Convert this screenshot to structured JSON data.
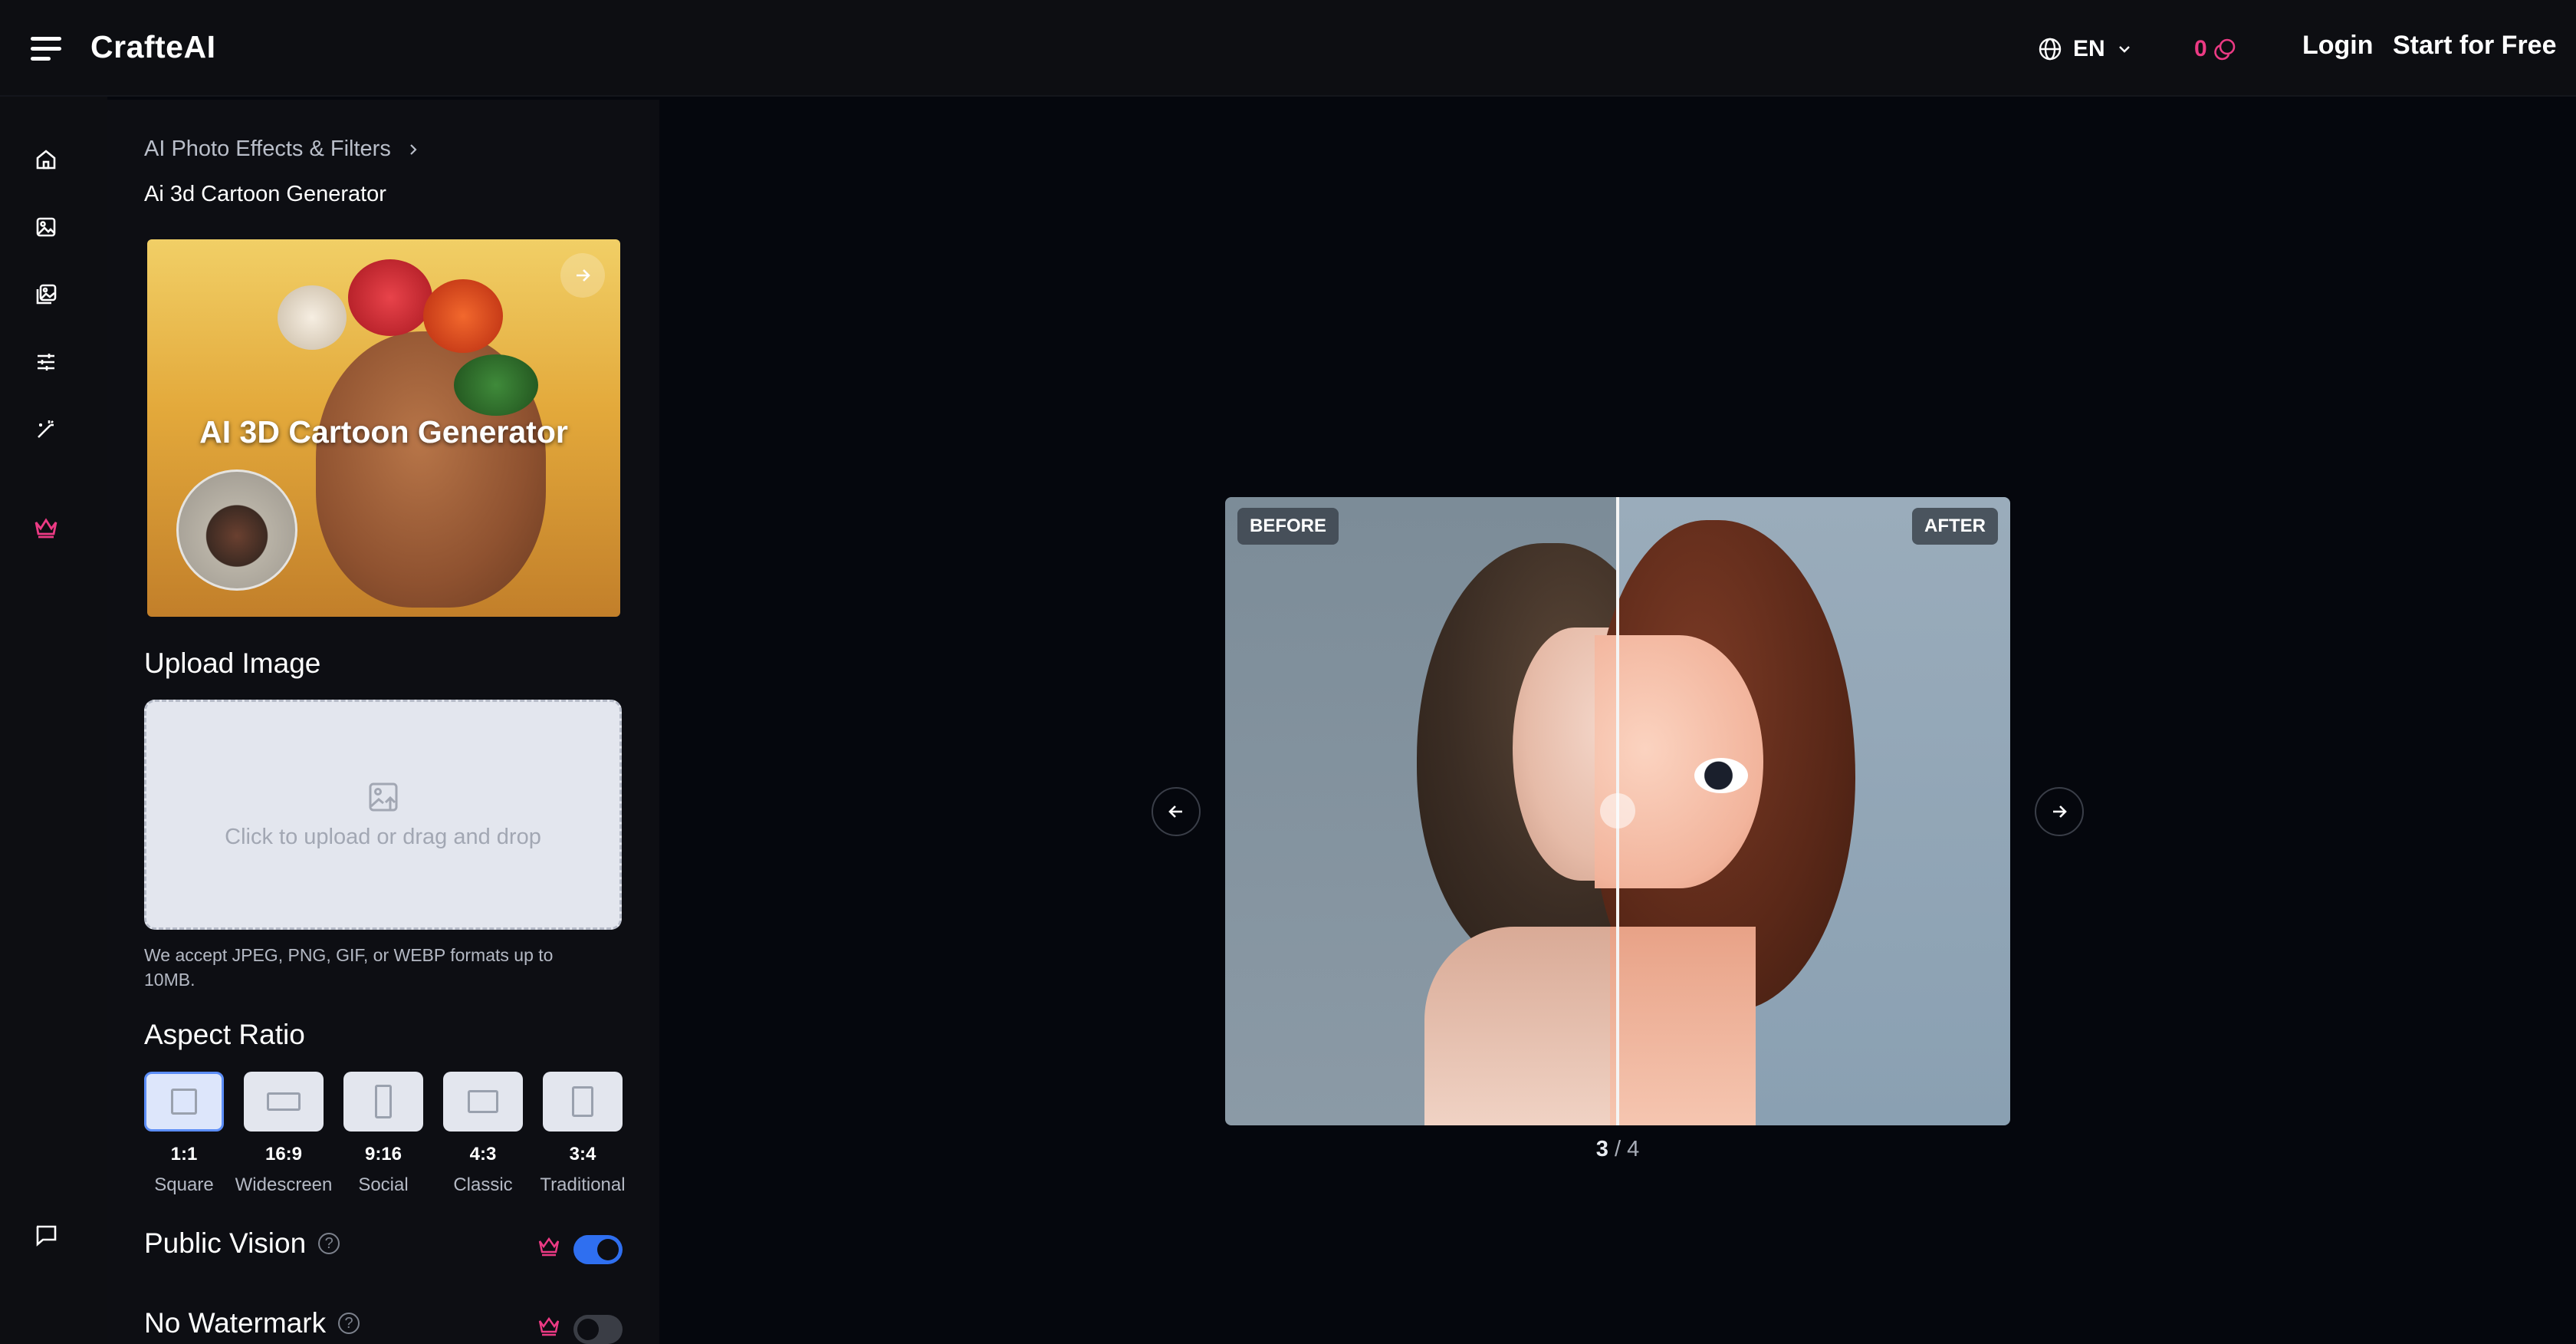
{
  "header": {
    "brand": "CrafteAI",
    "language": "EN",
    "credits": "0",
    "login_label": "Login",
    "start_label": "Start for Free"
  },
  "rail": {
    "icons": [
      "home-icon",
      "image-icon",
      "gallery-icon",
      "sliders-icon",
      "magic-wand-icon",
      "crown-icon",
      "chat-icon"
    ]
  },
  "panel": {
    "breadcrumb": "AI Photo Effects & Filters",
    "subtitle": "Ai 3d Cartoon Generator",
    "hero_title": "AI 3D Cartoon Generator",
    "upload_heading": "Upload Image",
    "upload_prompt": "Click to upload or drag and drop",
    "upload_note": "We accept JPEG, PNG, GIF, or WEBP formats up to 10MB.",
    "aspect_heading": "Aspect Ratio",
    "ratios": [
      {
        "value": "1:1",
        "label": "Square",
        "selected": true
      },
      {
        "value": "16:9",
        "label": "Widescreen",
        "selected": false
      },
      {
        "value": "9:16",
        "label": "Social",
        "selected": false
      },
      {
        "value": "4:3",
        "label": "Classic",
        "selected": false
      },
      {
        "value": "3:4",
        "label": "Traditional",
        "selected": false
      }
    ],
    "public_vision": {
      "label": "Public Vision",
      "help": "?",
      "enabled": true
    },
    "no_watermark": {
      "label": "No Watermark",
      "help": "?",
      "enabled": false
    }
  },
  "preview": {
    "before_label": "BEFORE",
    "after_label": "AFTER",
    "current_page": "3",
    "separator": " / ",
    "total_pages": "4"
  },
  "colors": {
    "accent_pink": "#ec3a84",
    "toggle_on": "#2f6ff0",
    "toggle_off": "#3a3d45",
    "background": "#05070d"
  }
}
